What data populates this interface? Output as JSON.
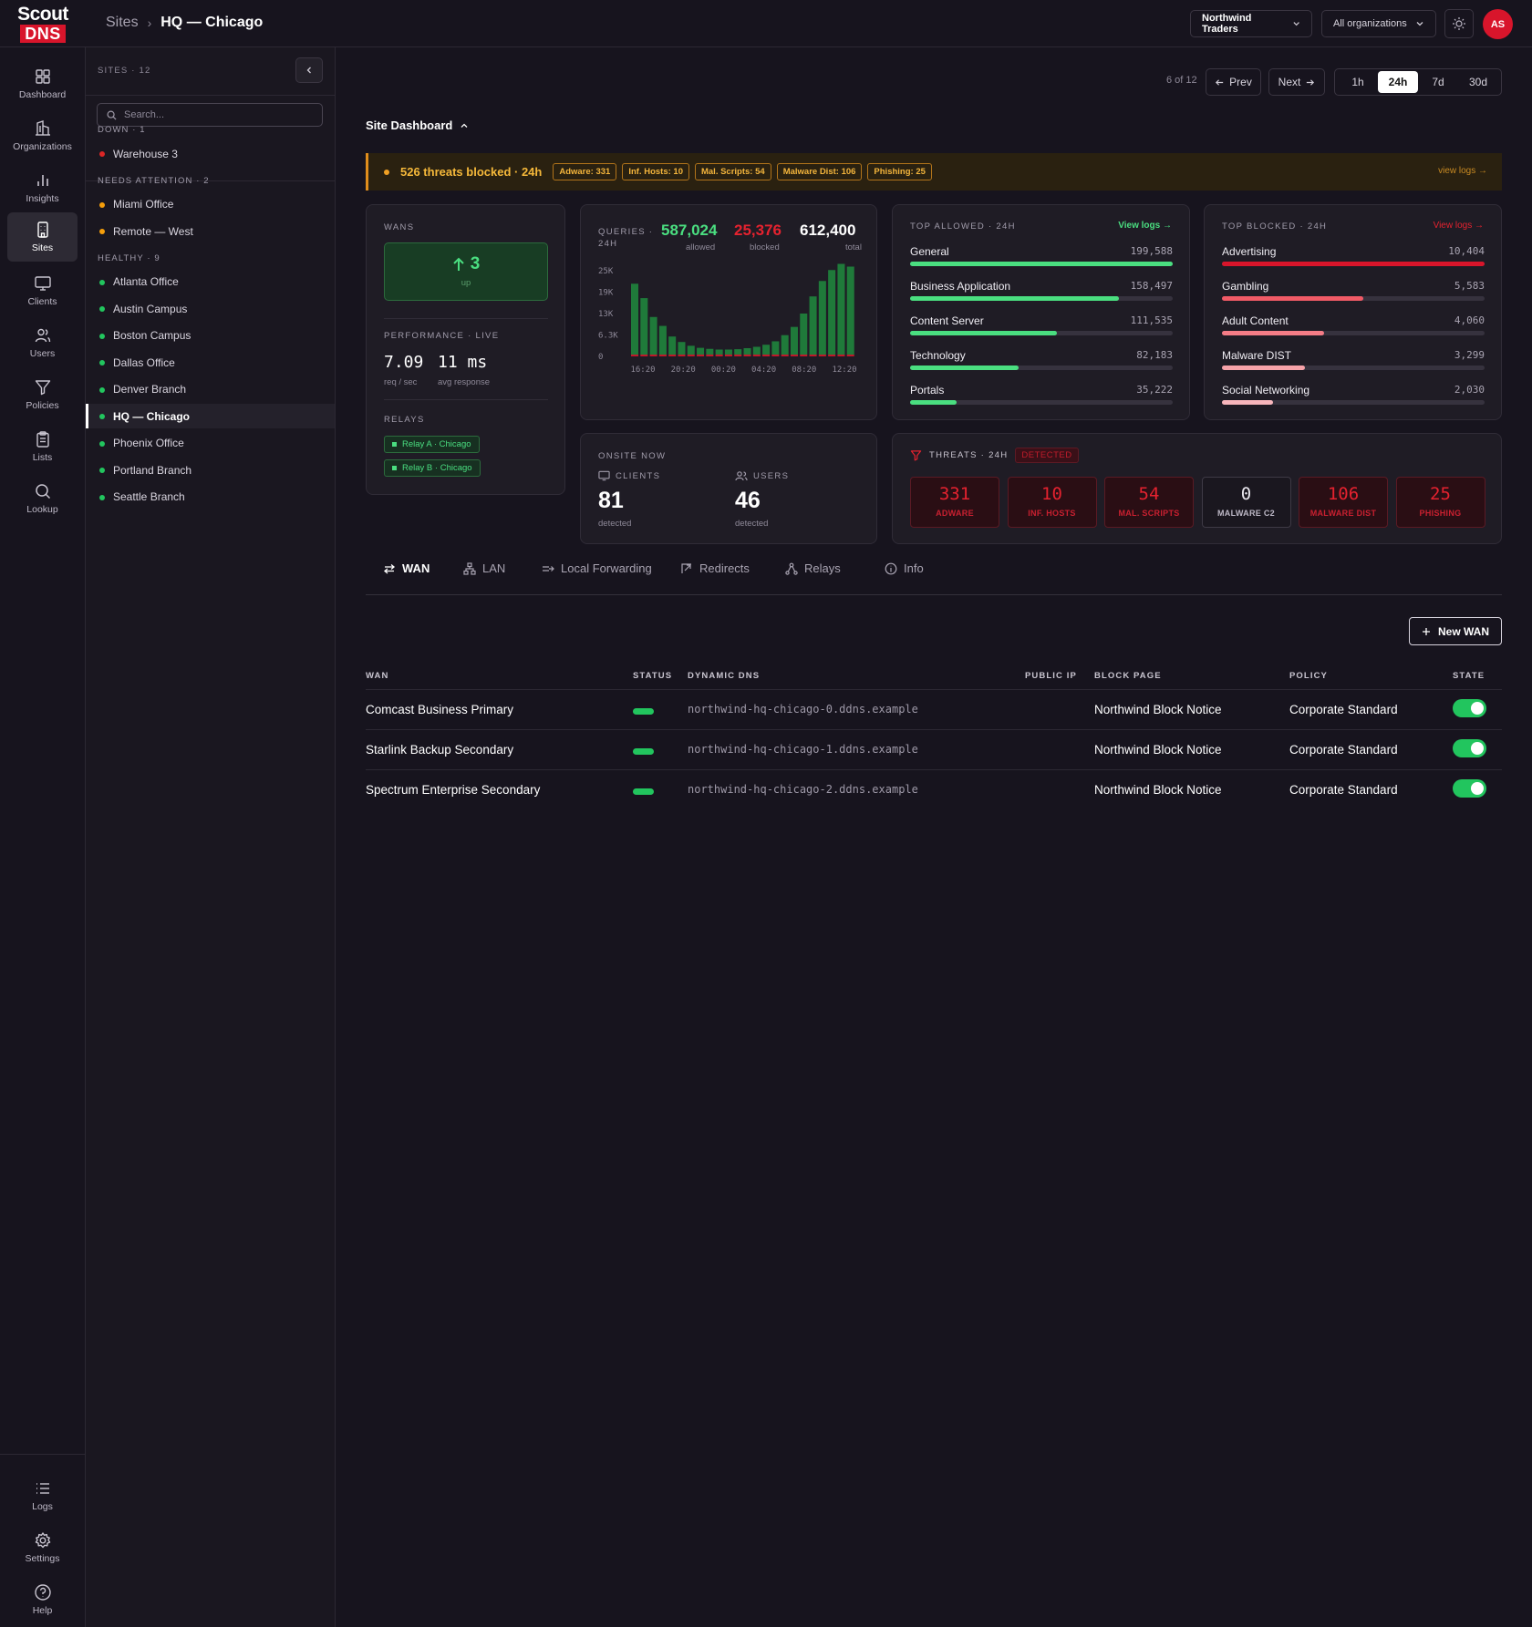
{
  "logo": {
    "line1": "Scout",
    "line2": "DNS"
  },
  "breadcrumb": {
    "parent": "Sites",
    "separator": "›",
    "current": "HQ — Chicago"
  },
  "header": {
    "org_select": "Northwind Traders",
    "scope_select": "All organizations",
    "avatar": "AS"
  },
  "nav": [
    {
      "label": "Dashboard",
      "icon": "dashboard-icon"
    },
    {
      "label": "Organizations",
      "icon": "building-icon"
    },
    {
      "label": "Insights",
      "icon": "bar-chart-icon"
    },
    {
      "label": "Sites",
      "icon": "site-icon",
      "active": true
    },
    {
      "label": "Clients",
      "icon": "monitor-icon"
    },
    {
      "label": "Users",
      "icon": "users-icon"
    },
    {
      "label": "Policies",
      "icon": "filter-icon"
    },
    {
      "label": "Lists",
      "icon": "clipboard-icon"
    },
    {
      "label": "Lookup",
      "icon": "search-icon"
    }
  ],
  "nav_bottom": [
    {
      "label": "Logs",
      "icon": "list-icon"
    },
    {
      "label": "Settings",
      "icon": "gear-icon"
    },
    {
      "label": "Help",
      "icon": "help-icon"
    }
  ],
  "sites_panel": {
    "title": "SITES · 12",
    "search_placeholder": "Search...",
    "groups": [
      {
        "title": "DOWN · 1",
        "color": "#dc2626",
        "sites": [
          "Warehouse 3"
        ]
      },
      {
        "title": "NEEDS ATTENTION · 2",
        "color": "#f59e0b",
        "sites": [
          "Miami Office",
          "Remote — West"
        ]
      },
      {
        "title": "HEALTHY · 9",
        "color": "#22c55e",
        "sites": [
          "Atlanta Office",
          "Austin Campus",
          "Boston Campus",
          "Dallas Office",
          "Denver Branch",
          "HQ — Chicago",
          "Phoenix Office",
          "Portland Branch",
          "Seattle Branch"
        ]
      }
    ],
    "active_site": "HQ — Chicago"
  },
  "pager": {
    "counter": "6 of 12",
    "prev": "Prev",
    "next": "Next"
  },
  "time_range": {
    "options": [
      "1h",
      "24h",
      "7d",
      "30d"
    ],
    "selected": "24h"
  },
  "dashboard_title": "Site Dashboard",
  "threat_banner": {
    "text": "526 threats blocked · 24h",
    "chips": [
      "Adware: 331",
      "Inf. Hosts: 10",
      "Mal. Scripts: 54",
      "Malware Dist: 106",
      "Phishing: 25"
    ],
    "link": "view logs →"
  },
  "wans_card": {
    "label": "WANS",
    "up_value": "3",
    "up_label": "up",
    "perf_label": "PERFORMANCE · LIVE",
    "rps": "7.09",
    "rps_label": "req / sec",
    "avg": "11 ms",
    "avg_label": "avg response",
    "relays_label": "RELAYS",
    "relays": [
      "Relay A · Chicago",
      "Relay B · Chicago"
    ]
  },
  "queries_card": {
    "label_line1": "QUERIES ·",
    "label_line2": "24H",
    "allowed": "587,024",
    "allowed_label": "allowed",
    "blocked": "25,376",
    "blocked_label": "blocked",
    "total": "612,400",
    "total_label": "total",
    "colors": {
      "allowed": "#1f7a3a",
      "blocked": "#c0182a"
    }
  },
  "chart_data": {
    "type": "bar",
    "y_tick_labels": [
      "25K",
      "19K",
      "13K",
      "6.3K",
      "0"
    ],
    "x_tick_labels": [
      "16:20",
      "20:20",
      "00:20",
      "04:20",
      "08:20",
      "12:20"
    ],
    "ylim": [
      0,
      25000
    ],
    "series": [
      {
        "name": "allowed",
        "values": [
          21200,
          17000,
          11500,
          8900,
          5800,
          4200,
          3100,
          2500,
          2200,
          2000,
          2000,
          2100,
          2400,
          2800,
          3400,
          4400,
          6200,
          8600,
          12500,
          17500,
          22000,
          25200,
          27000,
          26200
        ]
      },
      {
        "name": "blocked",
        "values": [
          600,
          500,
          400,
          300,
          250,
          200,
          150,
          120,
          110,
          100,
          100,
          100,
          120,
          140,
          160,
          200,
          260,
          340,
          450,
          600,
          800,
          900,
          1000,
          950
        ]
      }
    ]
  },
  "top_allowed": {
    "label": "TOP ALLOWED · 24H",
    "link": "View logs →",
    "color": "#4ade80",
    "items": [
      {
        "name": "General",
        "value": "199,588",
        "fraction": 1.0
      },
      {
        "name": "Business Application",
        "value": "158,497",
        "fraction": 0.794
      },
      {
        "name": "Content Server",
        "value": "111,535",
        "fraction": 0.559
      },
      {
        "name": "Technology",
        "value": "82,183",
        "fraction": 0.412
      },
      {
        "name": "Portals",
        "value": "35,222",
        "fraction": 0.176
      }
    ]
  },
  "top_blocked": {
    "label": "TOP BLOCKED · 24H",
    "link": "View logs →",
    "items": [
      {
        "name": "Advertising",
        "value": "10,404",
        "fraction": 1.0,
        "color": "#d8152b"
      },
      {
        "name": "Gambling",
        "value": "5,583",
        "fraction": 0.537,
        "color": "#f05a66"
      },
      {
        "name": "Adult Content",
        "value": "4,060",
        "fraction": 0.39,
        "color": "#f47c86"
      },
      {
        "name": "Malware DIST",
        "value": "3,299",
        "fraction": 0.317,
        "color": "#f6a2a9"
      },
      {
        "name": "Social Networking",
        "value": "2,030",
        "fraction": 0.195,
        "color": "#f8b6bc"
      }
    ]
  },
  "onsite": {
    "label": "ONSITE NOW",
    "clients_label": "CLIENTS",
    "clients": "81",
    "clients_sub": "detected",
    "users_label": "USERS",
    "users": "46",
    "users_sub": "detected"
  },
  "threats": {
    "label": "THREATS · 24H",
    "badge": "DETECTED",
    "items": [
      {
        "value": "331",
        "label": "ADWARE"
      },
      {
        "value": "10",
        "label": "INF. HOSTS"
      },
      {
        "value": "54",
        "label": "MAL. SCRIPTS"
      },
      {
        "value": "0",
        "label": "MALWARE C2"
      },
      {
        "value": "106",
        "label": "MALWARE DIST"
      },
      {
        "value": "25",
        "label": "PHISHING"
      }
    ]
  },
  "tabs": [
    {
      "label": "WAN",
      "icon": "wan-icon",
      "active": true
    },
    {
      "label": "LAN",
      "icon": "network-icon"
    },
    {
      "label": "Local Forwarding",
      "icon": "forward-icon"
    },
    {
      "label": "Redirects",
      "icon": "redirect-icon"
    },
    {
      "label": "Relays",
      "icon": "relay-icon"
    },
    {
      "label": "Info",
      "icon": "info-icon"
    }
  ],
  "new_wan_button": "New WAN",
  "wan_table": {
    "columns": [
      "WAN",
      "STATUS",
      "DYNAMIC DNS",
      "PUBLIC IP",
      "BLOCK PAGE",
      "POLICY",
      "STATE"
    ],
    "rows": [
      {
        "wan": "Comcast Business Primary",
        "ddns": "northwind-hq-chicago-0.ddns.example",
        "public_ip": "",
        "block_page": "Northwind Block Notice",
        "policy": "Corporate Standard",
        "state": "on",
        "status": "up"
      },
      {
        "wan": "Starlink Backup Secondary",
        "ddns": "northwind-hq-chicago-1.ddns.example",
        "public_ip": "",
        "block_page": "Northwind Block Notice",
        "policy": "Corporate Standard",
        "state": "on",
        "status": "up"
      },
      {
        "wan": "Spectrum Enterprise Secondary",
        "ddns": "northwind-hq-chicago-2.ddns.example",
        "public_ip": "",
        "block_page": "Northwind Block Notice",
        "policy": "Corporate Standard",
        "state": "on",
        "status": "up"
      }
    ]
  }
}
